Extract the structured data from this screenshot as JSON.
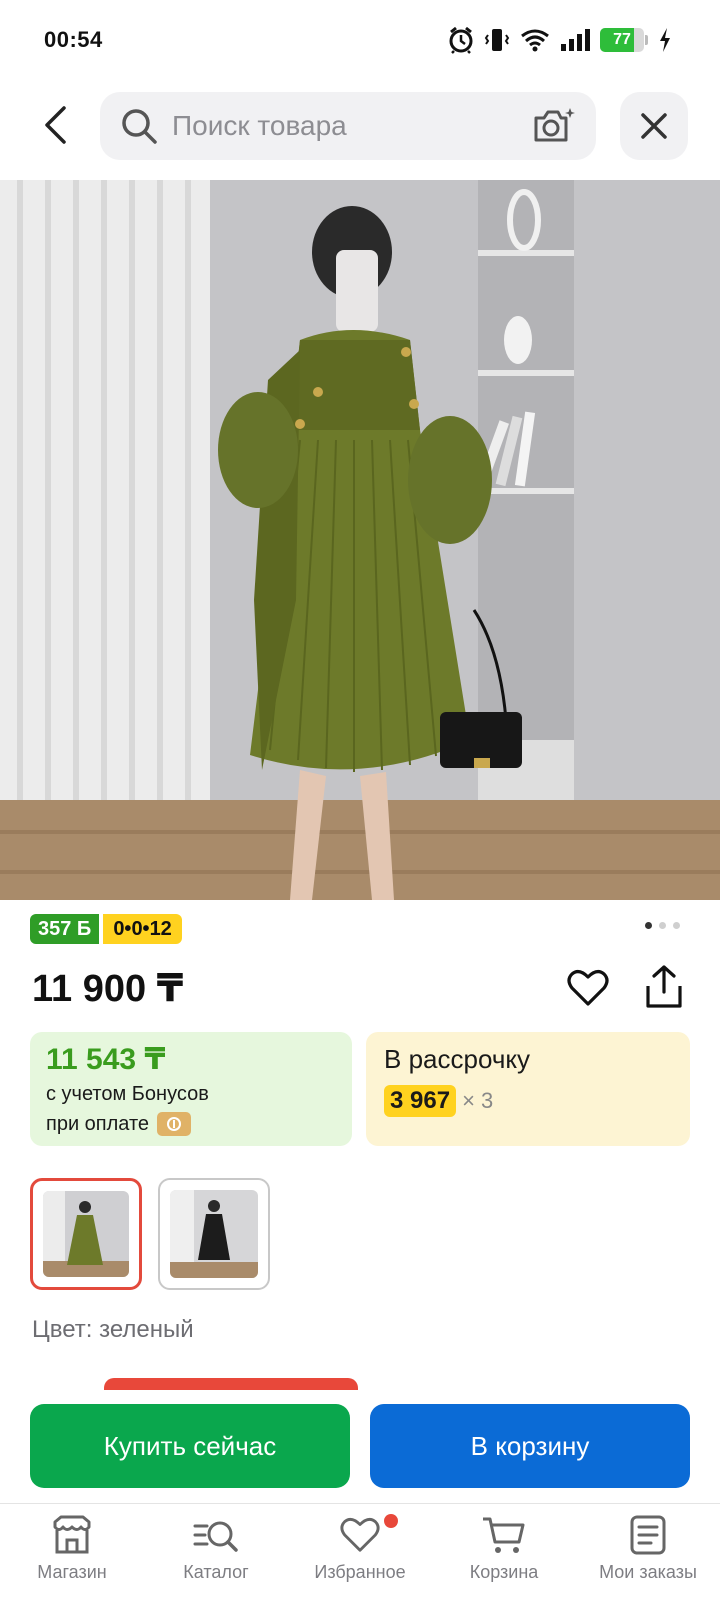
{
  "status_bar": {
    "time": "00:54",
    "battery_level": "77",
    "battery_fraction": 0.77,
    "battery_color": "#2ebd3a",
    "icons": [
      "alarm-icon",
      "vibrate-icon",
      "wifi-icon",
      "signal-icon",
      "battery-icon",
      "charging-icon"
    ]
  },
  "header": {
    "search_placeholder": "Поиск товара",
    "back_icon": "chevron-left-icon",
    "search_icon": "search-icon",
    "camera_icon": "camera-search-icon",
    "close_icon": "close-icon"
  },
  "gallery": {
    "current_index": 1,
    "total": 3
  },
  "badges": {
    "bonus": "357 Б",
    "installment_plan": "0•0•12"
  },
  "price": {
    "value": "11 900 ₸",
    "favorite_icon": "heart-icon",
    "share_icon": "share-icon"
  },
  "bonus_card": {
    "price": "11 543 ₸",
    "line1": "с учетом Бонусов",
    "line2": "при оплате",
    "accent_color": "#3a9c1e"
  },
  "installment_card": {
    "title": "В рассрочку",
    "amount": "3 967",
    "multiplier": "× 3"
  },
  "color": {
    "label": "Цвет: зеленый",
    "options": [
      {
        "name": "green",
        "selected": true
      },
      {
        "name": "black",
        "selected": false
      }
    ]
  },
  "actions": {
    "buy_now": "Купить сейчас",
    "add_to_cart": "В корзину",
    "buy_color": "#0aa74d",
    "cart_color": "#0b6bd6"
  },
  "bottom_nav": {
    "items": [
      {
        "label": "Магазин",
        "icon": "store-icon"
      },
      {
        "label": "Каталог",
        "icon": "catalog-search-icon"
      },
      {
        "label": "Избранное",
        "icon": "heart-icon",
        "has_notification": true
      },
      {
        "label": "Корзина",
        "icon": "cart-icon"
      },
      {
        "label": "Мои заказы",
        "icon": "orders-icon"
      }
    ]
  }
}
